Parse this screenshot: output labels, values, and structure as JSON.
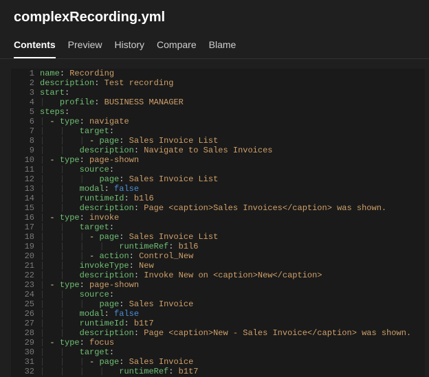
{
  "header": {
    "filename": "complexRecording.yml"
  },
  "tabs": {
    "items": [
      {
        "label": "Contents",
        "active": true
      },
      {
        "label": "Preview",
        "active": false
      },
      {
        "label": "History",
        "active": false
      },
      {
        "label": "Compare",
        "active": false
      },
      {
        "label": "Blame",
        "active": false
      }
    ]
  },
  "code": {
    "lines": [
      {
        "n": 1,
        "indent": 0,
        "dash": false,
        "key": "name",
        "value": "Recording",
        "vtype": "str"
      },
      {
        "n": 2,
        "indent": 0,
        "dash": false,
        "key": "description",
        "value": "Test recording",
        "vtype": "str"
      },
      {
        "n": 3,
        "indent": 0,
        "dash": false,
        "key": "start",
        "value": null
      },
      {
        "n": 4,
        "indent": 1,
        "dash": false,
        "key": "profile",
        "value": "BUSINESS MANAGER",
        "vtype": "str"
      },
      {
        "n": 5,
        "indent": 0,
        "dash": false,
        "key": "steps",
        "value": null
      },
      {
        "n": 6,
        "indent": 1,
        "dash": true,
        "key": "type",
        "value": "navigate",
        "vtype": "str"
      },
      {
        "n": 7,
        "indent": 2,
        "dash": false,
        "key": "target",
        "value": null
      },
      {
        "n": 8,
        "indent": 3,
        "dash": true,
        "key": "page",
        "value": "Sales Invoice List",
        "vtype": "str"
      },
      {
        "n": 9,
        "indent": 2,
        "dash": false,
        "key": "description",
        "value": "Navigate to Sales Invoices",
        "vtype": "str"
      },
      {
        "n": 10,
        "indent": 1,
        "dash": true,
        "key": "type",
        "value": "page-shown",
        "vtype": "str"
      },
      {
        "n": 11,
        "indent": 2,
        "dash": false,
        "key": "source",
        "value": null
      },
      {
        "n": 12,
        "indent": 3,
        "dash": false,
        "key": "page",
        "value": "Sales Invoice List",
        "vtype": "str"
      },
      {
        "n": 13,
        "indent": 2,
        "dash": false,
        "key": "modal",
        "value": "false",
        "vtype": "bool"
      },
      {
        "n": 14,
        "indent": 2,
        "dash": false,
        "key": "runtimeId",
        "value": "b1l6",
        "vtype": "str"
      },
      {
        "n": 15,
        "indent": 2,
        "dash": false,
        "key": "description",
        "value": "Page <caption>Sales Invoices</caption> was shown.",
        "vtype": "str"
      },
      {
        "n": 16,
        "indent": 1,
        "dash": true,
        "key": "type",
        "value": "invoke",
        "vtype": "str"
      },
      {
        "n": 17,
        "indent": 2,
        "dash": false,
        "key": "target",
        "value": null
      },
      {
        "n": 18,
        "indent": 3,
        "dash": true,
        "key": "page",
        "value": "Sales Invoice List",
        "vtype": "str"
      },
      {
        "n": 19,
        "indent": 4,
        "dash": false,
        "key": "runtimeRef",
        "value": "b1l6",
        "vtype": "str"
      },
      {
        "n": 20,
        "indent": 3,
        "dash": true,
        "key": "action",
        "value": "Control_New",
        "vtype": "str"
      },
      {
        "n": 21,
        "indent": 2,
        "dash": false,
        "key": "invokeType",
        "value": "New",
        "vtype": "str"
      },
      {
        "n": 22,
        "indent": 2,
        "dash": false,
        "key": "description",
        "value": "Invoke New on <caption>New</caption>",
        "vtype": "str"
      },
      {
        "n": 23,
        "indent": 1,
        "dash": true,
        "key": "type",
        "value": "page-shown",
        "vtype": "str"
      },
      {
        "n": 24,
        "indent": 2,
        "dash": false,
        "key": "source",
        "value": null
      },
      {
        "n": 25,
        "indent": 3,
        "dash": false,
        "key": "page",
        "value": "Sales Invoice",
        "vtype": "str"
      },
      {
        "n": 26,
        "indent": 2,
        "dash": false,
        "key": "modal",
        "value": "false",
        "vtype": "bool"
      },
      {
        "n": 27,
        "indent": 2,
        "dash": false,
        "key": "runtimeId",
        "value": "b1t7",
        "vtype": "str"
      },
      {
        "n": 28,
        "indent": 2,
        "dash": false,
        "key": "description",
        "value": "Page <caption>New - Sales Invoice</caption> was shown.",
        "vtype": "str"
      },
      {
        "n": 29,
        "indent": 1,
        "dash": true,
        "key": "type",
        "value": "focus",
        "vtype": "str"
      },
      {
        "n": 30,
        "indent": 2,
        "dash": false,
        "key": "target",
        "value": null
      },
      {
        "n": 31,
        "indent": 3,
        "dash": true,
        "key": "page",
        "value": "Sales Invoice",
        "vtype": "str"
      },
      {
        "n": 32,
        "indent": 4,
        "dash": false,
        "key": "runtimeRef",
        "value": "b1t7",
        "vtype": "str"
      }
    ]
  }
}
